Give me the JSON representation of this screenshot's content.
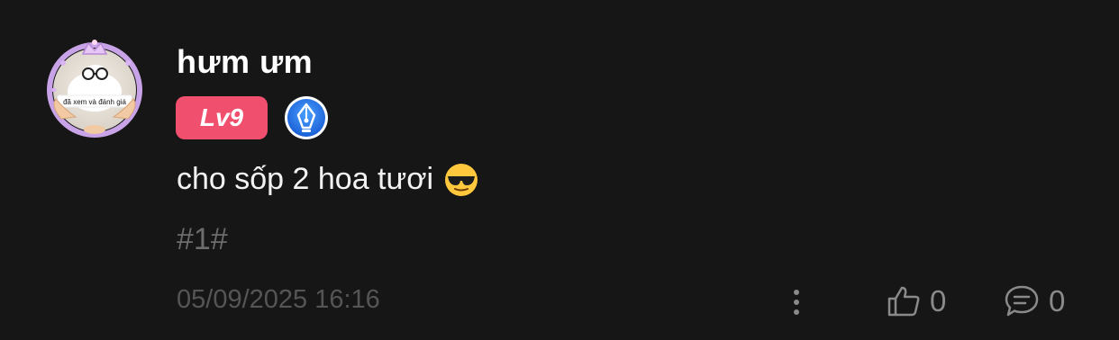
{
  "comment": {
    "author": {
      "name": "hưm ưm",
      "avatar_caption": "đã xem và đánh giá",
      "level": "Lv9",
      "level_color": "#f0506e",
      "badge_icon": "pen-nib-icon"
    },
    "text": "cho sốp 2 hoa tươi",
    "emoji": "sunglasses-face-icon",
    "tag": "#1#",
    "timestamp": "05/09/2025 16:16",
    "actions": {
      "more_icon": "vertical-dots-icon",
      "like_icon": "thumbs-up-icon",
      "like_count": "0",
      "reply_icon": "chat-bubble-icon",
      "reply_count": "0"
    }
  }
}
